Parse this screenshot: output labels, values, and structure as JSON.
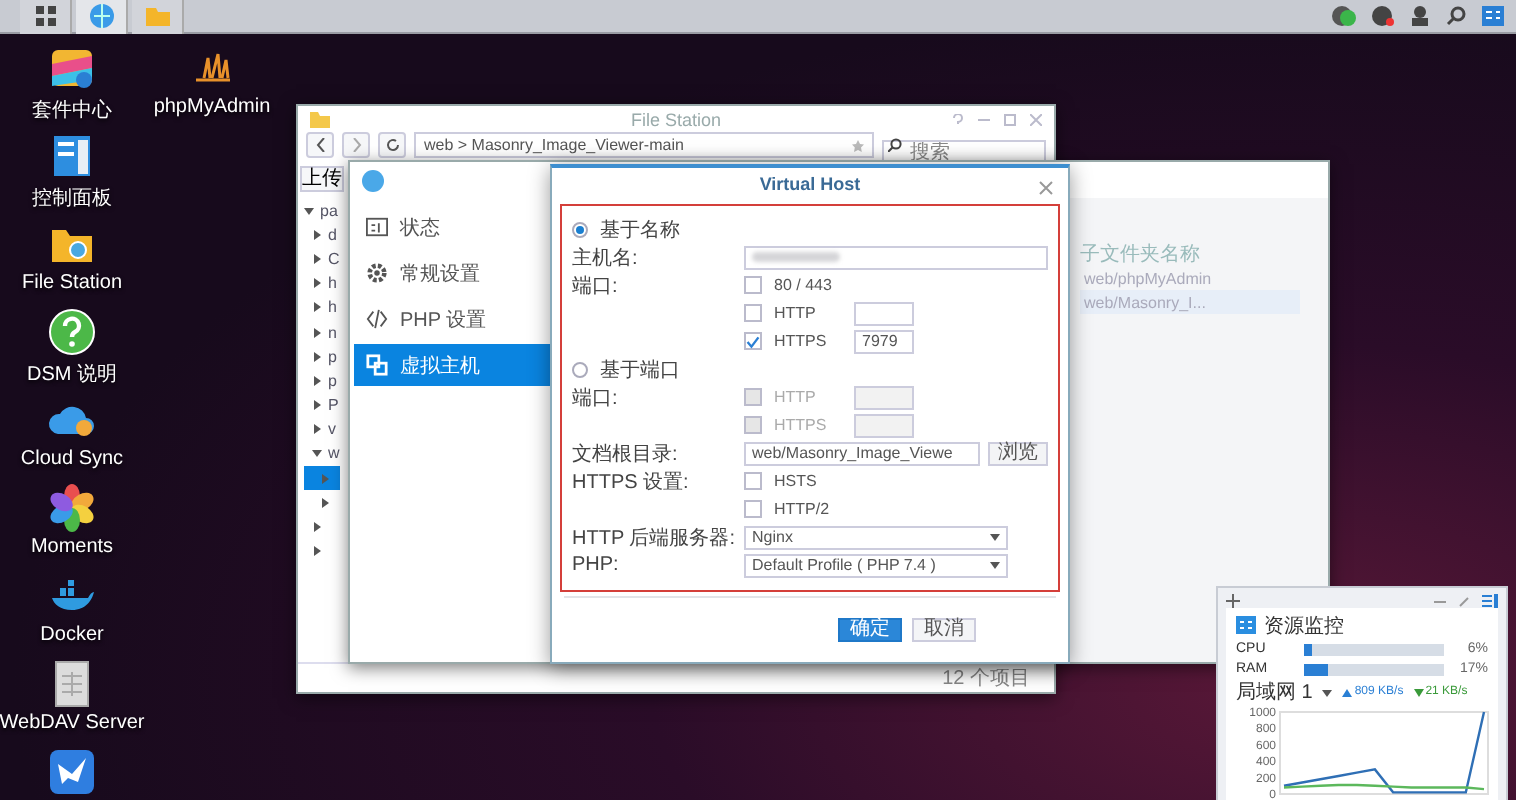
{
  "desktop_columns": [
    {
      "icons": [
        {
          "kind": "package",
          "label": "套件中心"
        },
        {
          "kind": "panel",
          "label": "控制面板"
        },
        {
          "kind": "folder",
          "label": "File Station"
        },
        {
          "kind": "help",
          "label": "DSM 说明"
        },
        {
          "kind": "cloud",
          "label": "Cloud Sync"
        },
        {
          "kind": "flower",
          "label": "Moments"
        },
        {
          "kind": "whale",
          "label": "Docker"
        },
        {
          "kind": "server",
          "label": "WebDAV Server"
        },
        {
          "kind": "bird"
        }
      ]
    },
    {
      "icons": [
        {
          "kind": "sails",
          "label": "phpMyAdmin"
        }
      ]
    }
  ],
  "file_station": {
    "title": "File Station",
    "path": "web > Masonry_Image_Viewer-main",
    "search": {
      "placeholder": "搜索"
    },
    "upload": "上传",
    "status": "12 个项目",
    "tree": [
      {
        "label": "pa",
        "expanded": true,
        "selected": false,
        "children": [
          {
            "label": "d",
            "expanded": false,
            "selected": false
          },
          {
            "label": "C",
            "expanded": false,
            "selected": false
          },
          {
            "label": "h",
            "expanded": false,
            "selected": false
          },
          {
            "label": "h",
            "expanded": false,
            "selected": false
          },
          {
            "label": "n",
            "expanded": false,
            "selected": false
          },
          {
            "label": "p",
            "expanded": false,
            "selected": false
          },
          {
            "label": "p",
            "expanded": false,
            "selected": false
          },
          {
            "label": "P",
            "expanded": false,
            "selected": false
          },
          {
            "label": "v",
            "expanded": false,
            "selected": false
          },
          {
            "label": "w",
            "expanded": true,
            "selected": false,
            "children": [
              {
                "expanded": false,
                "selected": true
              },
              {
                "expanded": false,
                "selected": false
              }
            ]
          },
          {
            "expanded": false,
            "selected": false
          },
          {
            "expanded": false,
            "selected": false
          }
        ]
      }
    ]
  },
  "web_station": {
    "sidebar": [
      {
        "kind": "status",
        "label": "状态",
        "selected": false
      },
      {
        "kind": "gear",
        "label": "常规设置",
        "selected": false
      },
      {
        "kind": "code",
        "label": "PHP 设置",
        "selected": false
      },
      {
        "kind": "host",
        "label": "虚拟主机",
        "selected": true
      }
    ],
    "table": {
      "columns": [
        "子文件夹名称"
      ],
      "rows": [
        {
          "cells": [
            "web/phpMyAdmin"
          ],
          "selected": false
        },
        {
          "cells": [
            "web/Masonry_I..."
          ],
          "selected": true
        }
      ]
    }
  },
  "dialog": {
    "title": "Virtual Host",
    "rows": [
      {
        "kind": "radio",
        "label": "基于名称",
        "selected": true
      },
      {
        "kind": "text",
        "label": "主机名:"
      },
      {
        "kind": "check",
        "label": "端口:",
        "option": "80 / 443",
        "checked": false,
        "disabled": false
      },
      {
        "kind": "port",
        "option": "HTTP",
        "checked": false,
        "disabled": false
      },
      {
        "kind": "port",
        "option": "HTTPS",
        "checked": true,
        "disabled": false,
        "value": "7979"
      },
      {
        "kind": "radio",
        "label": "基于端口",
        "selected": false
      },
      {
        "kind": "port",
        "label": "端口:",
        "option": "HTTP",
        "checked": false,
        "disabled": true
      },
      {
        "kind": "port",
        "option": "HTTPS",
        "checked": false,
        "disabled": true
      },
      {
        "kind": "browse",
        "label": "文档根目录:",
        "value": "web/Masonry_Image_Viewe",
        "button": "浏览"
      },
      {
        "kind": "check",
        "label": "HTTPS 设置:",
        "option": "HSTS",
        "checked": false,
        "disabled": false
      },
      {
        "kind": "check",
        "option": "HTTP/2",
        "checked": false,
        "disabled": false
      },
      {
        "kind": "select",
        "label": "HTTP 后端服务器:",
        "value": "Nginx"
      },
      {
        "kind": "select",
        "label": "PHP:",
        "value": "Default Profile ( PHP 7.4 )"
      }
    ],
    "buttons": [
      {
        "label": "确定",
        "primary": true
      },
      {
        "label": "取消",
        "primary": false
      }
    ]
  },
  "resource_monitor": {
    "title": "资源监控",
    "meters": [
      {
        "name": "CPU",
        "level": 0.06,
        "reading": "6%"
      },
      {
        "name": "RAM",
        "level": 0.17,
        "reading": "17%"
      }
    ],
    "network": {
      "interface": "局域网 1",
      "upload": "809 KB/s",
      "download": "21 KB/s"
    },
    "chart_data": {
      "type": "line",
      "ylim": [
        0,
        1000
      ],
      "yticks": [
        0,
        200,
        400,
        600,
        800,
        1000
      ],
      "series": [
        {
          "color": "#2f6fb5",
          "values": [
            100,
            140,
            180,
            220,
            260,
            300,
            20,
            20,
            20,
            20,
            20,
            1000
          ]
        },
        {
          "color": "#5cb85c",
          "values": [
            80,
            90,
            100,
            110,
            110,
            100,
            90,
            80,
            80,
            80,
            80,
            60
          ]
        }
      ]
    }
  }
}
